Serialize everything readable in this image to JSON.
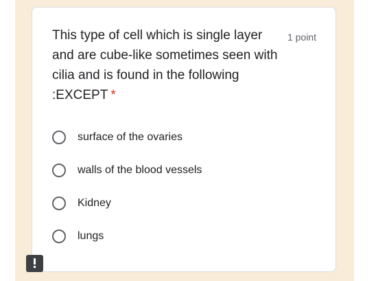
{
  "question": {
    "text": "This type of cell which is single layer and are cube-like sometimes seen with cilia and is found in the following :EXCEPT",
    "required_marker": "*",
    "points": "1 point"
  },
  "options": [
    {
      "label": "surface of the ovaries",
      "selected": false
    },
    {
      "label": "walls of the blood vessels",
      "selected": false
    },
    {
      "label": "Kidney",
      "selected": false
    },
    {
      "label": "lungs",
      "selected": false
    }
  ],
  "icons": {
    "report": "report-problem-icon"
  },
  "colors": {
    "background_accent": "#f9ecd8",
    "required": "#d93025",
    "radio_border": "#5f6368"
  }
}
